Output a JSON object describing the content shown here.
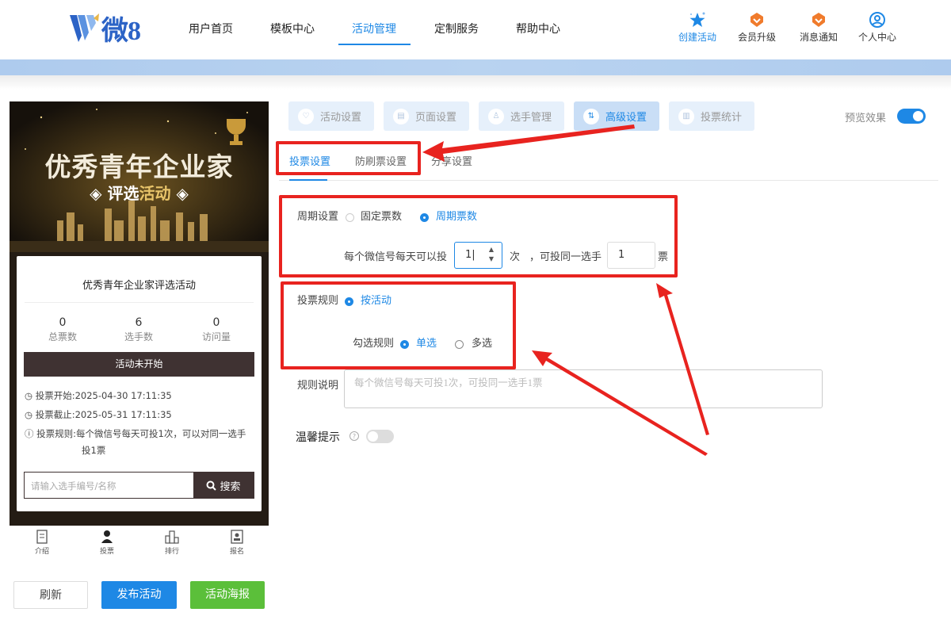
{
  "header": {
    "logo_text": "微8",
    "nav": [
      "用户首页",
      "模板中心",
      "活动管理",
      "定制服务",
      "帮助中心"
    ],
    "active_nav": "活动管理",
    "icons": [
      {
        "label": "创建活动",
        "icon": "star-sparkle-icon",
        "color": "#1e88e5"
      },
      {
        "label": "会员升级",
        "icon": "member-badge-icon",
        "color": "#f07b2c"
      },
      {
        "label": "消息通知",
        "icon": "message-badge-icon",
        "color": "#f07b2c"
      },
      {
        "label": "个人中心",
        "icon": "user-circle-icon",
        "color": "#1e88e5"
      }
    ]
  },
  "preview": {
    "banner_title": "优秀青年企业家",
    "banner_sub_a": "评选",
    "banner_sub_b": "活动",
    "card_title": "优秀青年企业家评选活动",
    "stats": [
      {
        "value": "0",
        "label": "总票数"
      },
      {
        "value": "6",
        "label": "选手数"
      },
      {
        "value": "0",
        "label": "访问量"
      }
    ],
    "status": "活动未开始",
    "start_label": "投票开始:",
    "start_time": "2025-04-30 17:11:35",
    "end_label": "投票截止:",
    "end_time": "2025-05-31 17:11:35",
    "rule_label": "投票规则:",
    "rule_text_1": "每个微信号每天可投1次，可以对同一选手",
    "rule_text_2": "投1票",
    "search_placeholder": "请输入选手编号/名称",
    "search_button": "搜索",
    "tabs": [
      "介绍",
      "投票",
      "排行",
      "报名"
    ]
  },
  "buttons": {
    "refresh": "刷新",
    "publish": "发布活动",
    "poster": "活动海报"
  },
  "settings": {
    "tabs": [
      "活动设置",
      "页面设置",
      "选手管理",
      "高级设置",
      "投票统计"
    ],
    "active_tab": "高级设置",
    "preview_label": "预览效果",
    "preview_on": true,
    "subtabs": [
      "投票设置",
      "防刷票设置",
      "分享设置"
    ],
    "active_subtab": "投票设置",
    "period_label": "周期设置",
    "period_options": [
      "固定票数",
      "周期票数"
    ],
    "period_selected": "周期票数",
    "per_day_label": "每个微信号每天可以投",
    "per_day_value": "1",
    "times_unit": "次",
    "same_player_label": "，可投同一选手",
    "same_player_value": "1",
    "ticket_unit": "票",
    "rule_label": "投票规则",
    "rule_option": "按活动",
    "select_rule_label": "勾选规则",
    "select_options": [
      "单选",
      "多选"
    ],
    "select_selected": "单选",
    "explain_label": "规则说明",
    "explain_placeholder": "每个微信号每天可投1次，可投同一选手1票",
    "tip_label": "温馨提示",
    "tip_on": false
  },
  "colors": {
    "accent": "#1e88e5",
    "annotation": "#e8231f",
    "dark_button": "#3f3232",
    "poster_green": "#5bbf3a"
  }
}
